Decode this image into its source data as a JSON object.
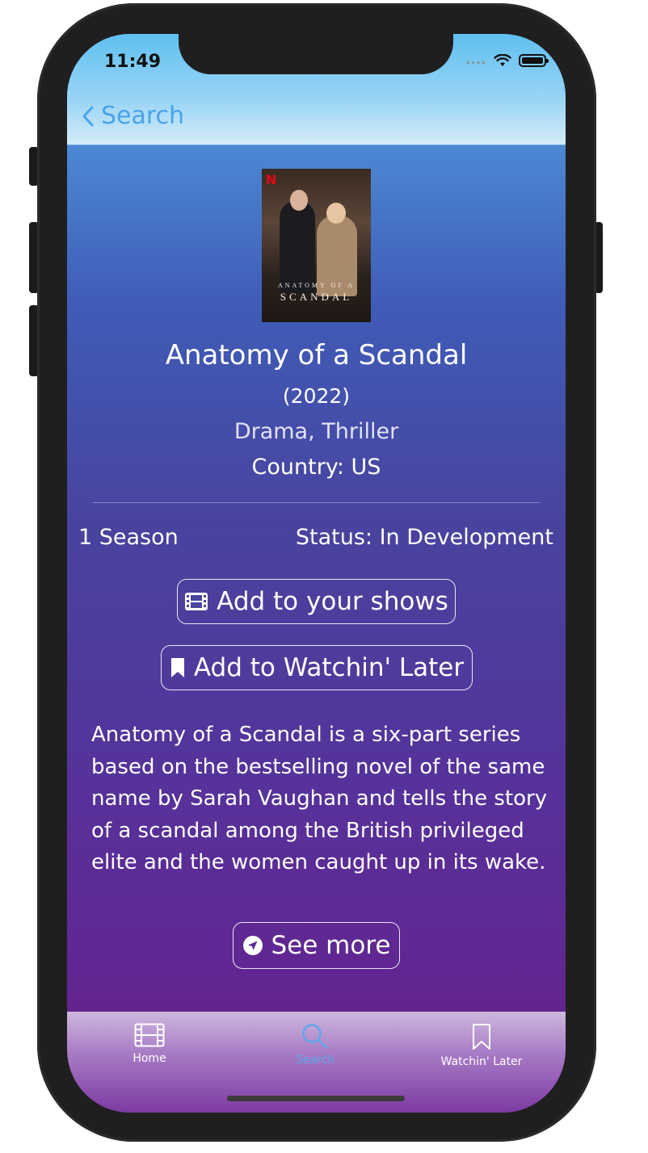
{
  "status_bar": {
    "time": "11:49",
    "signal_dots": "....",
    "wifi_icon": "wifi-icon",
    "battery_icon": "battery-icon"
  },
  "nav": {
    "back_label": "Search",
    "back_icon": "chevron-left-icon"
  },
  "show": {
    "poster_small_text": "ANATOMY OF A",
    "poster_big_text": "SCANDAL",
    "poster_badge": "N",
    "title": "Anatomy of a Scandal",
    "year": "(2022)",
    "genres": "Drama, Thriller",
    "country": "Country: US",
    "seasons": "1 Season",
    "status": "Status: In Development",
    "description": "Anatomy of a Scandal is a six-part series based on the bestselling novel of the same name by Sarah Vaughan and tells the story of a scandal among the British privileged elite and the women caught up in its wake."
  },
  "actions": {
    "add_shows_label": "Add to your shows",
    "add_shows_icon": "film-icon",
    "watch_later_label": "Add to Watchin' Later",
    "watch_later_icon": "bookmark-icon",
    "see_more_label": "See more",
    "see_more_icon": "location-arrow-icon"
  },
  "tabs": [
    {
      "label": "Home",
      "icon": "film-icon",
      "selected": false
    },
    {
      "label": "Search",
      "icon": "search-icon",
      "selected": true
    },
    {
      "label": "Watchin' Later",
      "icon": "bookmark-icon",
      "selected": false
    }
  ],
  "colors": {
    "accent": "#4aa3e9",
    "gradient_top": "#55a7e6",
    "gradient_bottom": "#6a1d8a"
  }
}
